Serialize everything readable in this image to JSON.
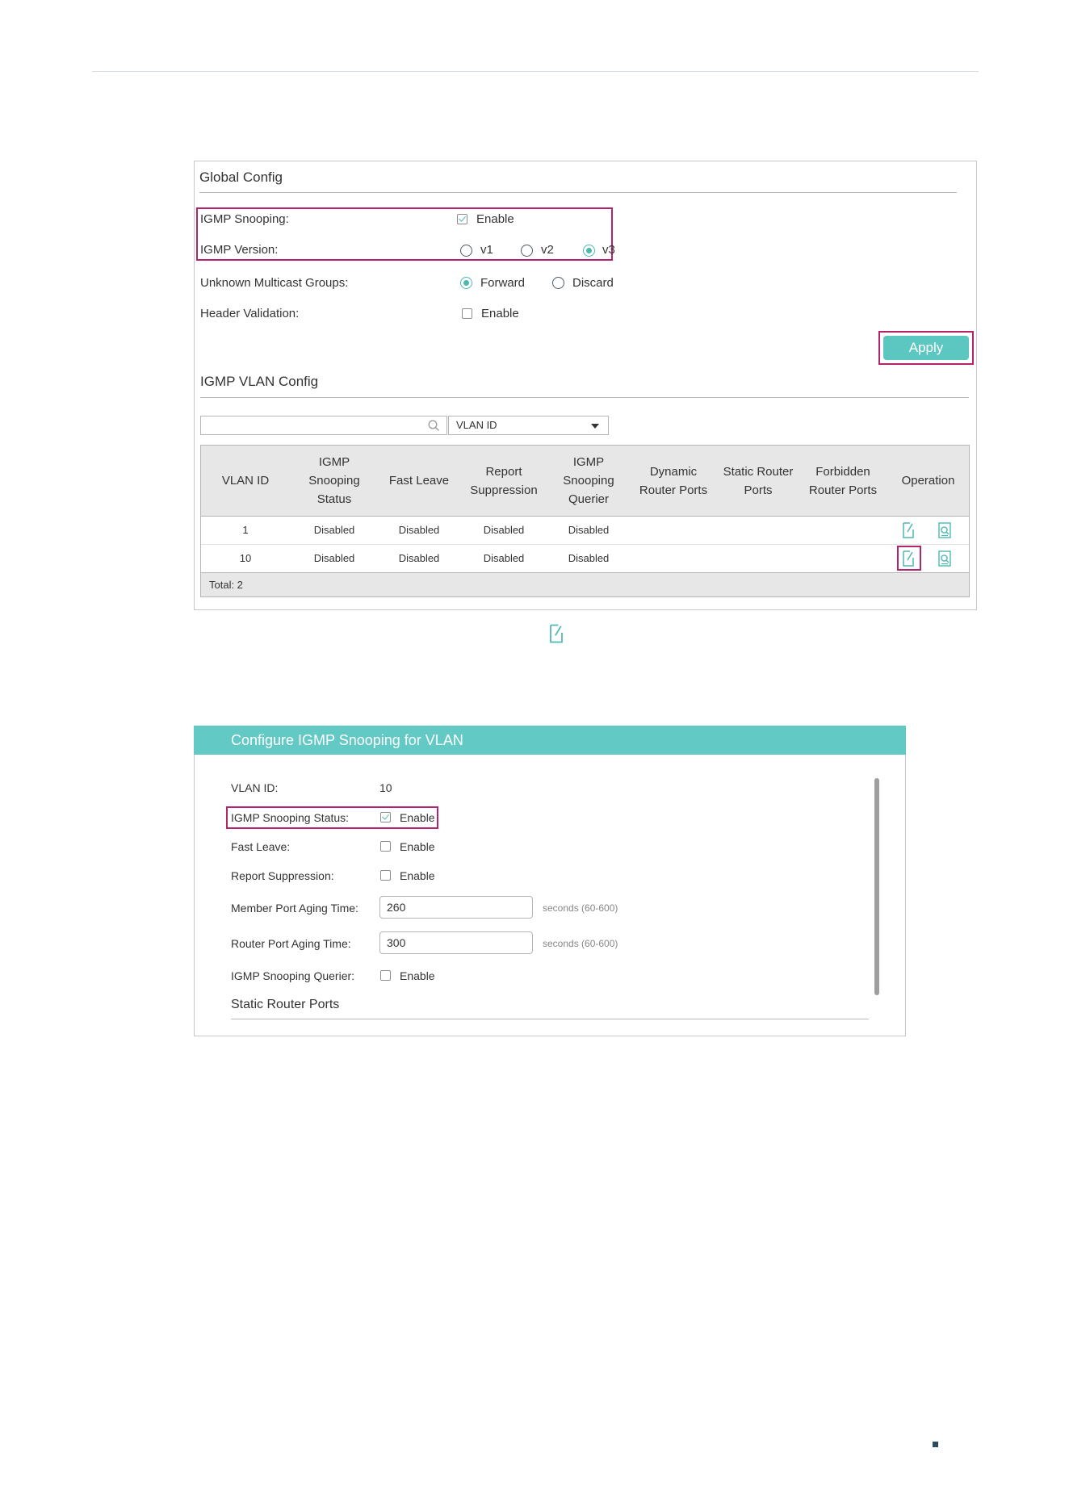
{
  "global_config": {
    "title": "Global Config",
    "igmp_snooping_label": "IGMP Snooping:",
    "igmp_snooping_enable": "Enable",
    "igmp_snooping_checked": true,
    "igmp_version_label": "IGMP Version:",
    "version_options": [
      "v1",
      "v2",
      "v3"
    ],
    "version_selected": "v3",
    "unknown_multicast_label": "Unknown Multicast Groups:",
    "unknown_multicast_options": [
      "Forward",
      "Discard"
    ],
    "unknown_multicast_selected": "Forward",
    "header_validation_label": "Header Validation:",
    "header_validation_enable": "Enable",
    "header_validation_checked": false,
    "apply_label": "Apply"
  },
  "vlan_config": {
    "title": "IGMP VLAN Config",
    "search_value": "",
    "filter_selected": "VLAN ID",
    "headers": [
      [
        "VLAN ID"
      ],
      [
        "IGMP",
        "Snooping",
        "Status"
      ],
      [
        "Fast Leave"
      ],
      [
        "Report",
        "Suppression"
      ],
      [
        "IGMP",
        "Snooping",
        "Querier"
      ],
      [
        "Dynamic",
        "Router Ports"
      ],
      [
        "Static Router",
        "Ports"
      ],
      [
        "Forbidden",
        "Router Ports"
      ],
      [
        "Operation"
      ]
    ],
    "rows": [
      {
        "vlan_id": "1",
        "snooping_status": "Disabled",
        "fast_leave": "Disabled",
        "report_suppression": "Disabled",
        "querier": "Disabled",
        "dynamic_router_ports": "",
        "static_router_ports": "",
        "forbidden_router_ports": ""
      },
      {
        "vlan_id": "10",
        "snooping_status": "Disabled",
        "fast_leave": "Disabled",
        "report_suppression": "Disabled",
        "querier": "Disabled",
        "dynamic_router_ports": "",
        "static_router_ports": "",
        "forbidden_router_ports": ""
      }
    ],
    "total_label": "Total: 2"
  },
  "dialog": {
    "title": "Configure IGMP Snooping for VLAN",
    "vlan_id_label": "VLAN ID:",
    "vlan_id_value": "10",
    "snooping_status_label": "IGMP Snooping Status:",
    "snooping_status_enable": "Enable",
    "snooping_status_checked": true,
    "fast_leave_label": "Fast Leave:",
    "fast_leave_enable": "Enable",
    "report_suppression_label": "Report Suppression:",
    "report_suppression_enable": "Enable",
    "member_aging_label": "Member Port Aging Time:",
    "member_aging_value": "260",
    "member_aging_hint": "seconds (60-600)",
    "router_aging_label": "Router Port Aging Time:",
    "router_aging_value": "300",
    "router_aging_hint": "seconds (60-600)",
    "querier_label": "IGMP Snooping Querier:",
    "querier_enable": "Enable",
    "static_router_ports_title": "Static Router Ports"
  },
  "colors": {
    "accent": "#5cc6c0",
    "highlight": "#b3246d",
    "header_bg": "#62c9c4"
  }
}
